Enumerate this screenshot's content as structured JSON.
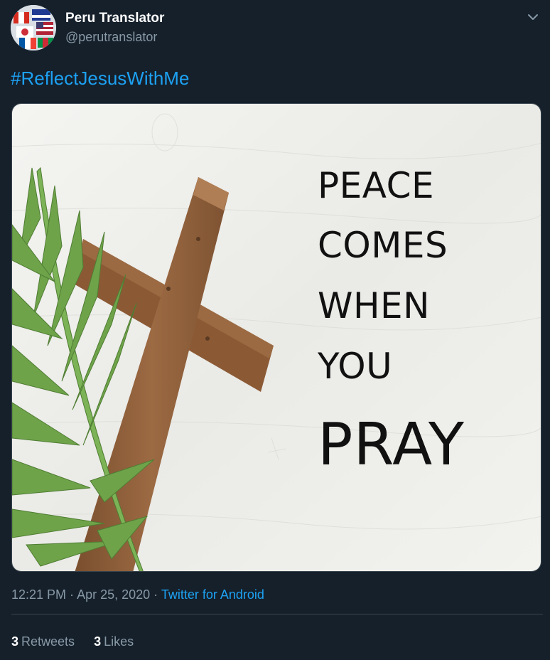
{
  "account": {
    "name": "Peru Translator",
    "handle": "@perutranslator"
  },
  "tweet": {
    "hashtag": "#ReflectJesusWithMe",
    "image_text": [
      "PEACE",
      "COMES",
      "WHEN",
      "YOU",
      "PRAY"
    ],
    "time": "12:21 PM",
    "separator": " · ",
    "date": "Apr 25, 2020",
    "source": "Twitter for Android"
  },
  "stats": {
    "retweets_count": "3",
    "retweets_label": "Retweets",
    "likes_count": "3",
    "likes_label": "Likes"
  },
  "colors": {
    "background": "#15202b",
    "link": "#1da1f2",
    "secondary_text": "#8899a6"
  }
}
